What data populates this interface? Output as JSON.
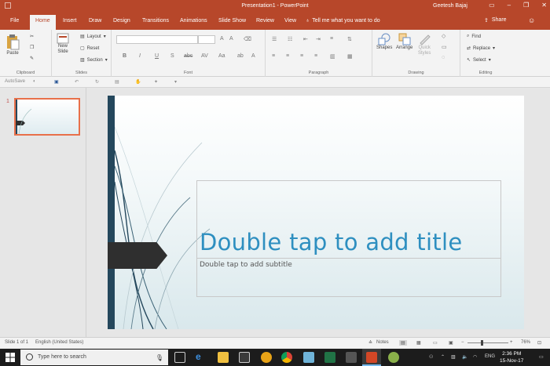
{
  "window": {
    "title": "Presentation1 - PowerPoint",
    "user": "Geetesh Bajaj"
  },
  "tabs": [
    "File",
    "Home",
    "Insert",
    "Draw",
    "Design",
    "Transitions",
    "Animations",
    "Slide Show",
    "Review",
    "View"
  ],
  "active_tab": "Home",
  "tell_me": "Tell me what you want to do",
  "share_label": "Share",
  "ribbon": {
    "clipboard": {
      "paste": "Paste",
      "label": "Clipboard"
    },
    "slides": {
      "new_slide_1": "New",
      "new_slide_2": "Slide",
      "layout": "Layout",
      "reset": "Reset",
      "section": "Section",
      "label": "Slides"
    },
    "font": {
      "label": "Font",
      "bold": "B",
      "italic": "I",
      "underline": "U",
      "strike": "S",
      "shadow": "abc",
      "spacing": "AV",
      "case": "Aa"
    },
    "paragraph": {
      "label": "Paragraph"
    },
    "drawing": {
      "shapes": "Shapes",
      "arrange": "Arrange",
      "quick_styles_1": "Quick",
      "quick_styles_2": "Styles",
      "label": "Drawing"
    },
    "editing": {
      "find": "Find",
      "replace": "Replace",
      "select": "Select",
      "label": "Editing"
    }
  },
  "toolbar2": {
    "autosave": "AutoSave"
  },
  "thumbnails": [
    {
      "number": "1"
    }
  ],
  "slide": {
    "title_placeholder": "Double tap to add title",
    "subtitle_placeholder": "Double tap to add subtitle"
  },
  "status": {
    "slide_count": "Slide 1 of 1",
    "language": "English (United States)",
    "notes": "Notes",
    "zoom": "76%",
    "zoom_out": "−",
    "zoom_in": "+"
  },
  "taskbar": {
    "search_placeholder": "Type here to search",
    "lang": "ENG",
    "time": "2:36 PM",
    "date": "15-Nov-17"
  },
  "colors": {
    "accent": "#b7472a",
    "title_text": "#2e8fc0",
    "slide_bar": "#24475c"
  }
}
